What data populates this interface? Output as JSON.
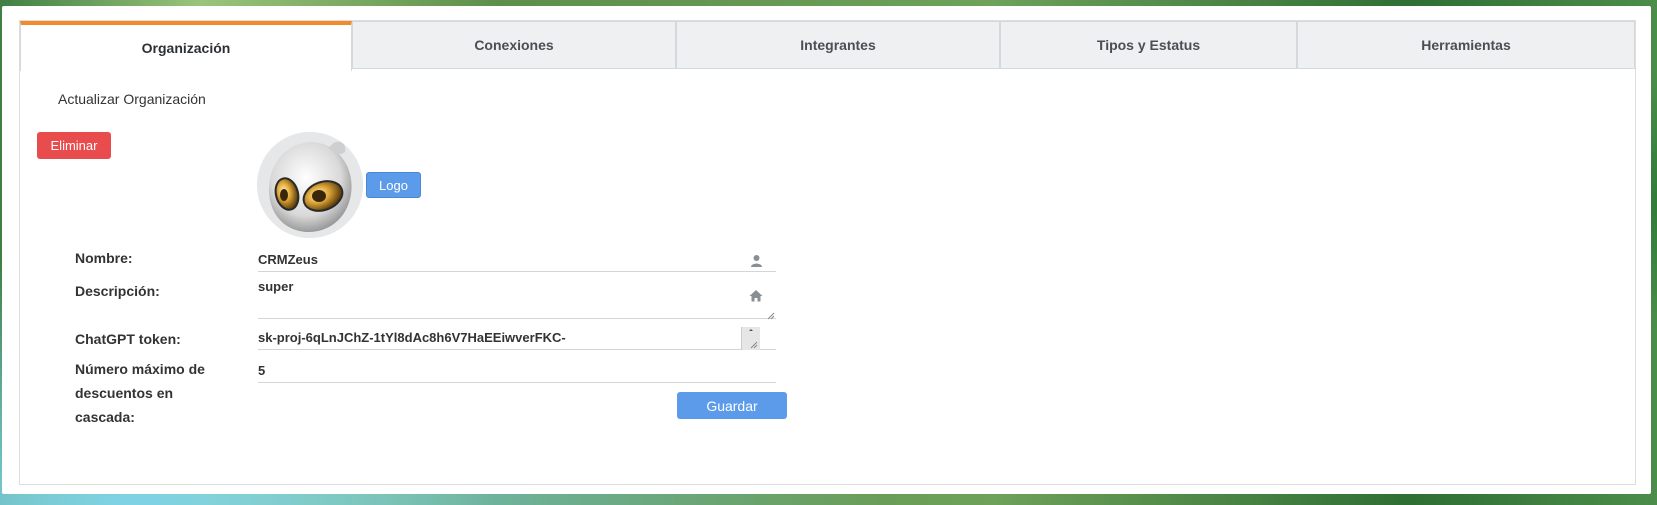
{
  "tabs": [
    {
      "label": "Organización",
      "active": true
    },
    {
      "label": "Conexiones",
      "active": false
    },
    {
      "label": "Integrantes",
      "active": false
    },
    {
      "label": "Tipos y Estatus",
      "active": false
    },
    {
      "label": "Herramientas",
      "active": false
    }
  ],
  "section": {
    "title": "Actualizar Organización"
  },
  "actions": {
    "delete_label": "Eliminar",
    "logo_label": "Logo",
    "save_label": "Guardar"
  },
  "form": {
    "nombre": {
      "label": "Nombre:",
      "value": "CRMZeus",
      "icon": "user-icon"
    },
    "descripcion": {
      "label": "Descripción:",
      "value": "super",
      "icon": "home-icon"
    },
    "chatgpt": {
      "label": "ChatGPT token:",
      "value": "sk-proj-6qLnJChZ-1tYl8dAc8h6V7HaEEiwverFKC-"
    },
    "descuentos": {
      "label": "Número máximo de descuentos en cascada:",
      "value": "5"
    }
  },
  "colors": {
    "accent_tab": "#f28b2c",
    "primary": "#5c9bea",
    "danger": "#e84c4c"
  }
}
